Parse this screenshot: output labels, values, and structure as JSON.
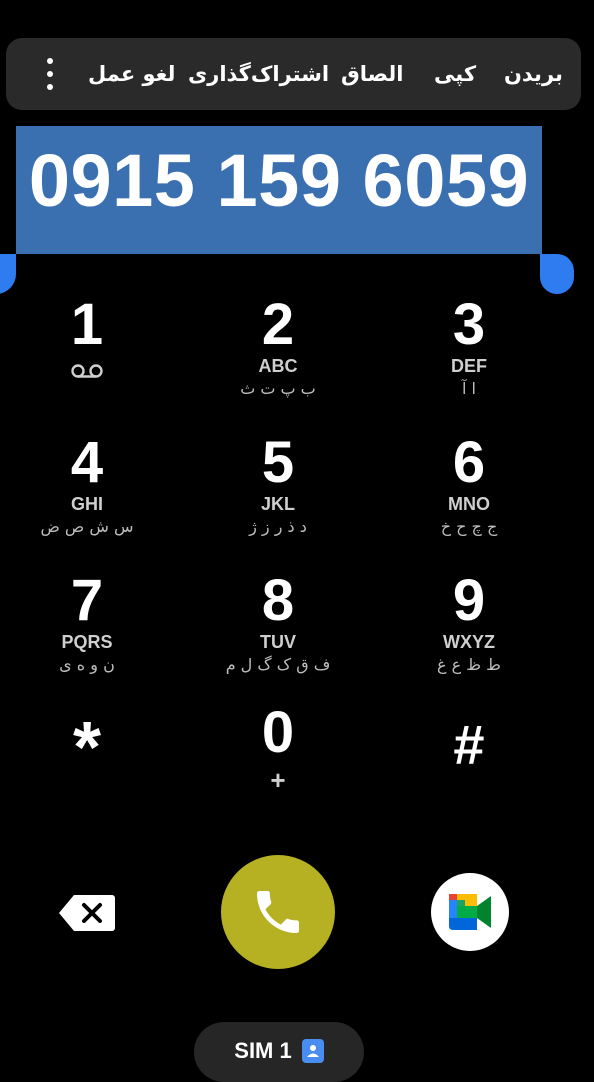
{
  "context_menu": {
    "items": [
      {
        "label": "بریدن"
      },
      {
        "label": "کپی"
      },
      {
        "label": "الصاق"
      },
      {
        "label": "اشتراک‌گذاری"
      },
      {
        "label": "لغو عمل"
      }
    ],
    "more_icon": "more-vertical-icon"
  },
  "dialed_number": "0915 159 6059",
  "keypad": {
    "keys": [
      {
        "digit": "1",
        "letters": "",
        "persian": "",
        "icon": "voicemail-icon"
      },
      {
        "digit": "2",
        "letters": "ABC",
        "persian": "ب پ ت ث"
      },
      {
        "digit": "3",
        "letters": "DEF",
        "persian": "ا آ"
      },
      {
        "digit": "4",
        "letters": "GHI",
        "persian": "س ش ص ض"
      },
      {
        "digit": "5",
        "letters": "JKL",
        "persian": "د ذ ر ز ژ"
      },
      {
        "digit": "6",
        "letters": "MNO",
        "persian": "ج چ ح خ"
      },
      {
        "digit": "7",
        "letters": "PQRS",
        "persian": "ن و ه ی"
      },
      {
        "digit": "8",
        "letters": "TUV",
        "persian": "ف ق ک گ ل م"
      },
      {
        "digit": "9",
        "letters": "WXYZ",
        "persian": "ط ظ ع غ"
      },
      {
        "digit": "*",
        "letters": "",
        "persian": ""
      },
      {
        "digit": "0",
        "letters": "+",
        "persian": ""
      },
      {
        "digit": "#",
        "letters": "",
        "persian": ""
      }
    ]
  },
  "actions": {
    "backspace_icon": "backspace-icon",
    "call_icon": "phone-icon",
    "meet_icon": "google-meet-icon",
    "call_color": "#b6b122"
  },
  "sim": {
    "label": "SIM 1",
    "icon": "contact-card-icon"
  },
  "colors": {
    "background": "#000000",
    "selection": "#3a6fb0",
    "handles": "#2f7bf0",
    "menu_bg": "#2a2a2a"
  }
}
